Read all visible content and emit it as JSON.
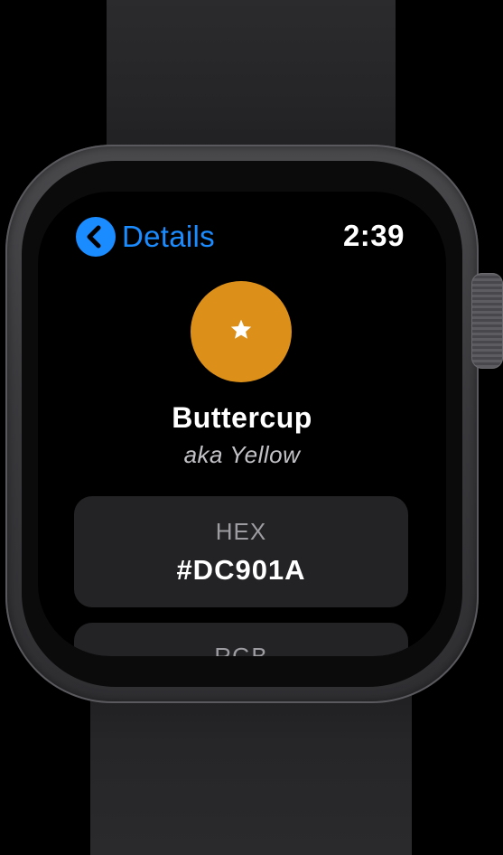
{
  "nav": {
    "back_label": "Details",
    "back_icon": "chevron-left-icon"
  },
  "status": {
    "time": "2:39"
  },
  "color": {
    "name": "Buttercup",
    "alias": "aka Yellow",
    "swatch_color": "#DC901A",
    "favorite_icon": "star-icon"
  },
  "cards": {
    "hex": {
      "label": "HEX",
      "value": "#DC901A"
    },
    "rgb": {
      "label": "RGB"
    }
  },
  "colors": {
    "accent": "#1a8cff",
    "card_background": "#232325",
    "screen_background": "#000000"
  }
}
